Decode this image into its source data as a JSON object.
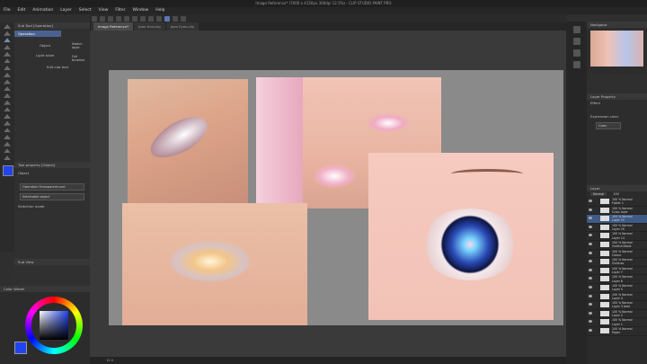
{
  "title": "Image Reference* (7000 x 4150px 300dpi 12.5%)  - CLIP STUDIO PAINT PRO",
  "menu": [
    "File",
    "Edit",
    "Animation",
    "Layer",
    "Select",
    "View",
    "Filter",
    "Window",
    "Help"
  ],
  "tabs": [
    "Image Reference*",
    "Jean Hair.clip",
    "Jean Eyes.clip"
  ],
  "subtool": {
    "header": "Sub Tool [Operation]",
    "items": [
      "Operation",
      "Object",
      "Light table",
      "Edit cab text"
    ],
    "right_labels": [
      "Switch layer",
      "Full timeline"
    ]
  },
  "tool_property": {
    "header": "Tool property [Object]",
    "label": "Object",
    "fields": [
      "Operation:Transparent part",
      "Selectable object"
    ],
    "selection_mode": "Selection mode"
  },
  "navigator_sub": {
    "header": "Sub View"
  },
  "color": {
    "header": "Color Wheel",
    "primary": "#2244ee",
    "accent": "#3a5bdc"
  },
  "status": "12.5",
  "navigator": {
    "header": "Navigator"
  },
  "layer_property": {
    "header": "Layer Property",
    "effect": "Effect",
    "expression": "Expression color",
    "expression_value": "Color"
  },
  "layers": {
    "header": "Layer",
    "blend": "Normal",
    "opacity": "100",
    "rows": [
      {
        "t1": "100 % Normal",
        "t2": "Folder 1"
      },
      {
        "t1": "100 % Normal",
        "t2": "Cross layer"
      },
      {
        "t1": "100 % Normal",
        "t2": "Layer 15"
      },
      {
        "t1": "100 % Normal",
        "t2": "Layer 16"
      },
      {
        "t1": "100 % Normal",
        "t2": "Layer 14"
      },
      {
        "t1": "100 % Normal",
        "t2": "Outline Blank"
      },
      {
        "t1": "100 % Normal",
        "t2": "Colour"
      },
      {
        "t1": "100 % Normal",
        "t2": "Outlines"
      },
      {
        "t1": "100 % Normal",
        "t2": "Layer 7"
      },
      {
        "t1": "100 % Normal",
        "t2": "Layer 6"
      },
      {
        "t1": "100 % Normal",
        "t2": "Layer 5"
      },
      {
        "t1": "100 % Normal",
        "t2": "Layer 4"
      },
      {
        "t1": "100 % Normal",
        "t2": "Layer 3 bast"
      },
      {
        "t1": "100 % Normal",
        "t2": "Layer 2"
      },
      {
        "t1": "100 % Normal",
        "t2": "Layer 1"
      },
      {
        "t1": "100 % Normal",
        "t2": "Paper"
      }
    ]
  }
}
